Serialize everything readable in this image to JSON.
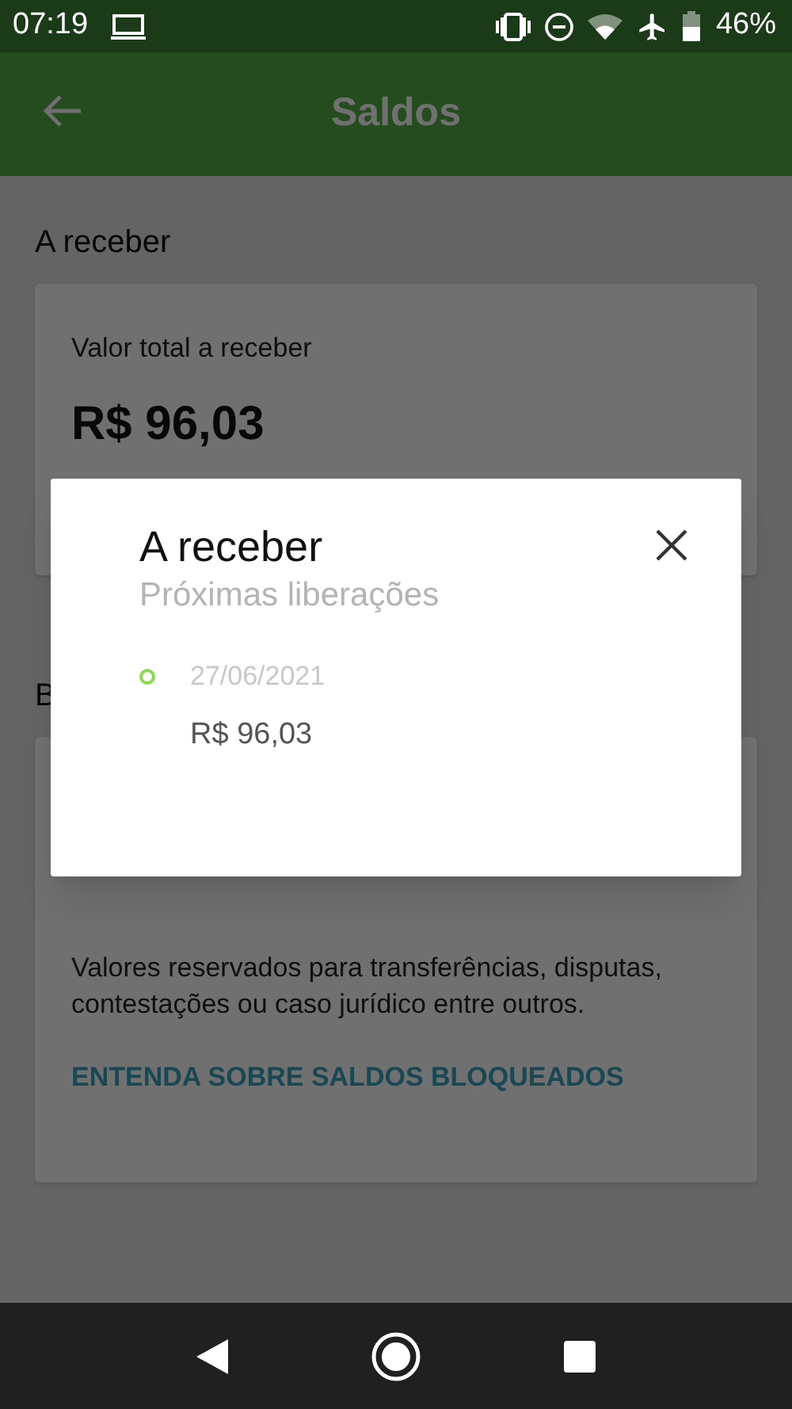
{
  "status_bar": {
    "time": "07:19",
    "battery": "46%"
  },
  "app_bar": {
    "title": "Saldos"
  },
  "sections": [
    {
      "heading": "A receber",
      "card": {
        "label": "Valor total a receber",
        "amount": "R$ 96,03"
      }
    },
    {
      "heading": "B",
      "card": {
        "description": "Valores reservados para transferências, disputas, contestações ou caso jurídico entre outros.",
        "link": "ENTENDA SOBRE SALDOS BLOQUEADOS"
      }
    }
  ],
  "dialog": {
    "title": "A receber",
    "subtitle": "Próximas liberações",
    "entries": [
      {
        "date": "27/06/2021",
        "amount": "R$ 96,03",
        "color": "#8ad94e"
      }
    ]
  }
}
